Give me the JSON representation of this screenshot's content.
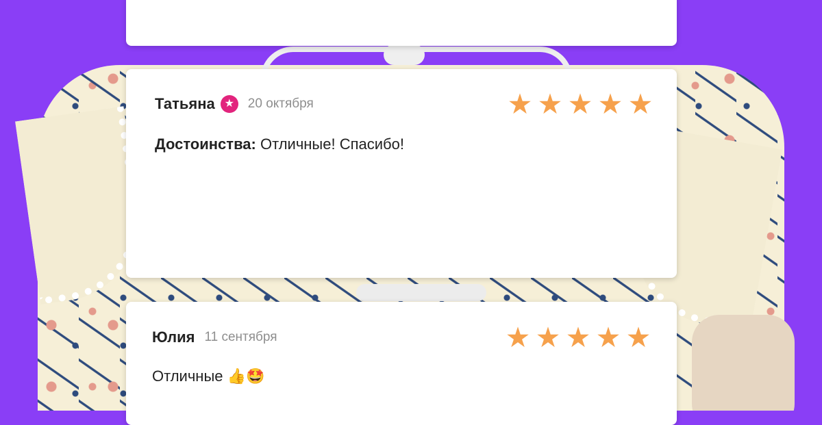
{
  "reviews": [
    {
      "author": "Татьяна",
      "date": "20 октября",
      "rating": 5,
      "label": "Достоинства:",
      "text": " Отличные! Спасибо!",
      "badge_icon": "star-badge-icon",
      "badge_color": "#e2247d"
    },
    {
      "author": "Юлия",
      "date": "11 сентября",
      "rating": 5,
      "text": "Отличные 👍🤩"
    }
  ],
  "colors": {
    "background": "#8a3ef6",
    "star": "#f6a14c",
    "date": "#8e8e8e"
  }
}
